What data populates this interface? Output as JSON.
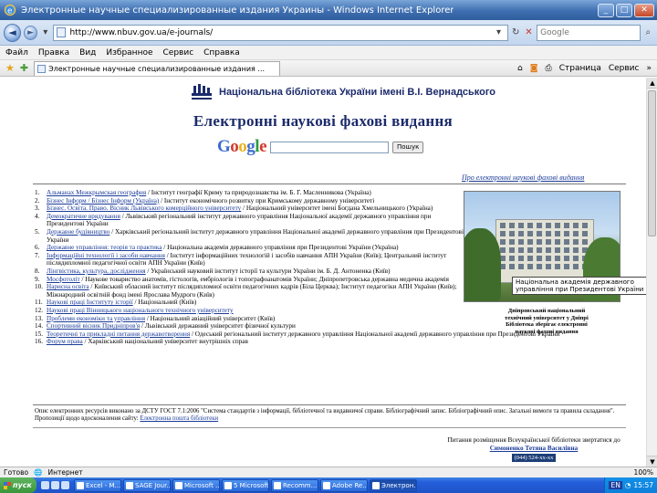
{
  "window": {
    "title": "Электронные научные специализированные издания Украины - Windows Internet Explorer"
  },
  "address": {
    "url": "http://www.nbuv.gov.ua/e-journals/",
    "search_placeholder": "Google"
  },
  "menu": [
    "Файл",
    "Правка",
    "Вид",
    "Избранное",
    "Сервис",
    "Справка"
  ],
  "favbar": {
    "tab_title": "Электронные научные специализированные издания ...",
    "commands": [
      "Страница",
      "Сервис"
    ]
  },
  "page": {
    "library_name": "Національна бібліотека України імені В.І. Вернадського",
    "title": "Електронні наукові фахові видання",
    "google_logo": "Google",
    "google_button": "Пошук",
    "list_link": "Про електронні наукові фахові видання",
    "journals": [
      {
        "num": "1.",
        "name": "Альманах Межкрымская география",
        "rest": "/ Інститут географії Криму та природознавства ім. Б. Г. Масленникова (Україна)"
      },
      {
        "num": "2.",
        "name": "Бізнес Інформ / Бізнес Інформ (Україна)",
        "rest": "/ Інститут економічного розвитку при Кримському державному університеті"
      },
      {
        "num": "3.",
        "name": "Бізнес. Освіта. Право. Вісник Львівського комерційного університету",
        "rest": "/ Національний університет імені Богдана Хмельницького (Україна)"
      },
      {
        "num": "4.",
        "name": "Демократичне врядування",
        "rest": "/ Львівський регіональний інститут державного управління Національної академії державного управління при Президентові України"
      },
      {
        "num": "5.",
        "name": "Державне будівництво",
        "rest": "/ Харківський регіональний інститут державного управління Національної академії державного управління при Президентові України"
      },
      {
        "num": "6.",
        "name": "Державне управління: теорія та практика",
        "rest": "/ Національна академія державного управління при Президентові України (Україна)"
      },
      {
        "num": "7.",
        "name": "Інформаційні технології і засоби навчання",
        "rest": "/ Інститут інформаційних технологій і засобів навчання АПН України (Київ); Центральний інститут післядипломної педагогічної освіти АПН України (Київ)"
      },
      {
        "num": "8.",
        "name": "Лінгвістика, культура, дослідження",
        "rest": "/ Український науковий інститут історії та культури України ім. Б. Д. Антоненка (Київ)"
      },
      {
        "num": "9.",
        "name": "Мосфотоліт",
        "rest": "/ Наукове товариство анатомів, гістологів, ембріологів і топографоанатомів України; Дніпропетровська державна медична академія"
      },
      {
        "num": "10.",
        "name": "Нарисна освіта",
        "rest": "/ Київський обласний інститут післядипломної освіти педагогічних кадрів (Біла Церква); Інститут педагогіки АПН України (Київ); Міжнародний освітній фонд імені Ярослава Мудрого (Київ)"
      },
      {
        "num": "11.",
        "name": "Наукові праці Інституту історії",
        "rest": "/ Національний (Київ)"
      },
      {
        "num": "12.",
        "name": "Наукові праці Вінницького національного технічного університету",
        "rest": ""
      },
      {
        "num": "13.",
        "name": "Проблеми економіки та управління",
        "rest": "/ Національний авіаційний університет (Київ)"
      },
      {
        "num": "14.",
        "name": "Спортивний вісник Придніпров'я",
        "rest": "/ Львівський державний університет фізичної культури"
      },
      {
        "num": "15.",
        "name": "Теоретичні та прикладні питання державотворення",
        "rest": "/ Одеський регіональний інститут державного управління Національної академії державного управління при Президентові України"
      },
      {
        "num": "16.",
        "name": "Форум права",
        "rest": "/ Харківський національний університет внутрішніх справ"
      }
    ],
    "tooltip": "Національна академія державного управління при Президентові України",
    "photo_caption": "Дніпровський національний технічний університет у Дніпрі Бібліотека зберігає електронні наукові фахові видання",
    "footer_note": "Опис електронних ресурсів виконано за ДСТУ ГОСТ 7.1:2006 \"Система стандартів з інформації, бібліотечної та видавничої справи. Бібліографічний запис. Бібліографічний опис. Загальні вимоги та правила складання\". Пропозиції щодо вдосконалення сайту:",
    "footer_link": "Електронна пошта бібліотеки",
    "credit_line": "Питання розміщення Всеукраїнської бібліотеки звертатися до",
    "credit_author": "Симоненко Тетяна Василівна",
    "counter": "(044) 524-xx-xx"
  },
  "status": {
    "left": "Готово",
    "zone": "Интернет",
    "zoom": "100%"
  },
  "taskbar": {
    "start": "пуск",
    "tasks": [
      "Excel - M...",
      "SAGE Jour...",
      "Microsoft ...",
      "5 Microsoft...",
      "Recomm...",
      "Adobe Re...",
      "Электрон..."
    ],
    "lang": "EN",
    "clock": "15:57"
  }
}
